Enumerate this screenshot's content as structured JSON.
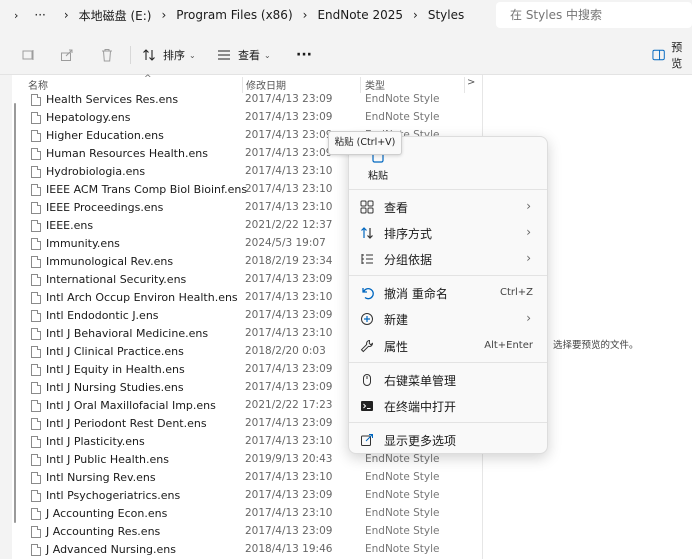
{
  "address": {
    "more": "···",
    "crumbs": [
      "本地磁盘 (E:)",
      "Program Files (x86)",
      "EndNote 2025",
      "Styles"
    ],
    "search_placeholder": "在 Styles 中搜索"
  },
  "toolbar": {
    "sort_label": "排序",
    "view_label": "查看",
    "more": "···",
    "preview_label": "预览"
  },
  "columns": {
    "name": "名称",
    "date": "修改日期",
    "type": "类型"
  },
  "files": [
    {
      "name": "Health Services Res.ens",
      "date": "2017/4/13 23:09",
      "type": "EndNote Style"
    },
    {
      "name": "Hepatology.ens",
      "date": "2017/4/13 23:09",
      "type": "EndNote Style"
    },
    {
      "name": "Higher Education.ens",
      "date": "2017/4/13 23:09",
      "type": "EndNote Style"
    },
    {
      "name": "Human Resources Health.ens",
      "date": "2017/4/13 23:09",
      "type": ""
    },
    {
      "name": "Hydrobiologia.ens",
      "date": "2017/4/13 23:10",
      "type": ""
    },
    {
      "name": "IEEE ACM Trans Comp Biol Bioinf.ens",
      "date": "2017/4/13 23:10",
      "type": ""
    },
    {
      "name": "IEEE Proceedings.ens",
      "date": "2017/4/13 23:10",
      "type": ""
    },
    {
      "name": "IEEE.ens",
      "date": "2021/2/22 12:37",
      "type": ""
    },
    {
      "name": "Immunity.ens",
      "date": "2024/5/3 19:07",
      "type": ""
    },
    {
      "name": "Immunological Rev.ens",
      "date": "2018/2/19 23:34",
      "type": ""
    },
    {
      "name": "International Security.ens",
      "date": "2017/4/13 23:09",
      "type": ""
    },
    {
      "name": "Intl Arch Occup Environ Health.ens",
      "date": "2017/4/13 23:10",
      "type": ""
    },
    {
      "name": "Intl Endodontic J.ens",
      "date": "2017/4/13 23:09",
      "type": ""
    },
    {
      "name": "Intl J Behavioral Medicine.ens",
      "date": "2017/4/13 23:10",
      "type": ""
    },
    {
      "name": "Intl J Clinical Practice.ens",
      "date": "2018/2/20 0:03",
      "type": ""
    },
    {
      "name": "Intl J Equity in Health.ens",
      "date": "2017/4/13 23:09",
      "type": ""
    },
    {
      "name": "Intl J Nursing Studies.ens",
      "date": "2017/4/13 23:09",
      "type": ""
    },
    {
      "name": "Intl J Oral Maxillofacial Imp.ens",
      "date": "2021/2/22 17:23",
      "type": ""
    },
    {
      "name": "Intl J Periodont Rest Dent.ens",
      "date": "2017/4/13 23:09",
      "type": ""
    },
    {
      "name": "Intl J Plasticity.ens",
      "date": "2017/4/13 23:10",
      "type": ""
    },
    {
      "name": "Intl J Public Health.ens",
      "date": "2019/9/13 20:43",
      "type": "EndNote Style"
    },
    {
      "name": "Intl Nursing Rev.ens",
      "date": "2017/4/13 23:10",
      "type": "EndNote Style"
    },
    {
      "name": "Intl Psychogeriatrics.ens",
      "date": "2017/4/13 23:09",
      "type": "EndNote Style"
    },
    {
      "name": "J Accounting Econ.ens",
      "date": "2017/4/13 23:10",
      "type": "EndNote Style"
    },
    {
      "name": "J Accounting Res.ens",
      "date": "2017/4/13 23:09",
      "type": "EndNote Style"
    },
    {
      "name": "J Advanced Nursing.ens",
      "date": "2018/4/13 19:46",
      "type": "EndNote Style"
    }
  ],
  "preview_message": "选择要预览的文件。",
  "tooltip": "粘贴 (Ctrl+V)",
  "context_menu": {
    "paste_label": "粘贴",
    "items": [
      {
        "label": "查看",
        "icon": "grid-icon",
        "arrow": "›",
        "shortcut": ""
      },
      {
        "label": "排序方式",
        "icon": "sort-icon",
        "arrow": "›",
        "shortcut": ""
      },
      {
        "label": "分组依据",
        "icon": "group-icon",
        "arrow": "›",
        "shortcut": ""
      },
      {
        "label": "撤消 重命名",
        "icon": "undo-icon",
        "arrow": "",
        "shortcut": "Ctrl+Z"
      },
      {
        "label": "新建",
        "icon": "plus-circle-icon",
        "arrow": "›",
        "shortcut": ""
      },
      {
        "label": "属性",
        "icon": "wrench-icon",
        "arrow": "",
        "shortcut": "Alt+Enter"
      },
      {
        "label": "右键菜单管理",
        "icon": "mouse-icon",
        "arrow": "",
        "shortcut": ""
      },
      {
        "label": "在终端中打开",
        "icon": "terminal-icon",
        "arrow": "",
        "shortcut": ""
      },
      {
        "label": "显示更多选项",
        "icon": "share-icon",
        "arrow": "",
        "shortcut": ""
      }
    ]
  },
  "colors": {
    "accent": "#0067c0",
    "menu_bg": "#f9f9f9"
  }
}
